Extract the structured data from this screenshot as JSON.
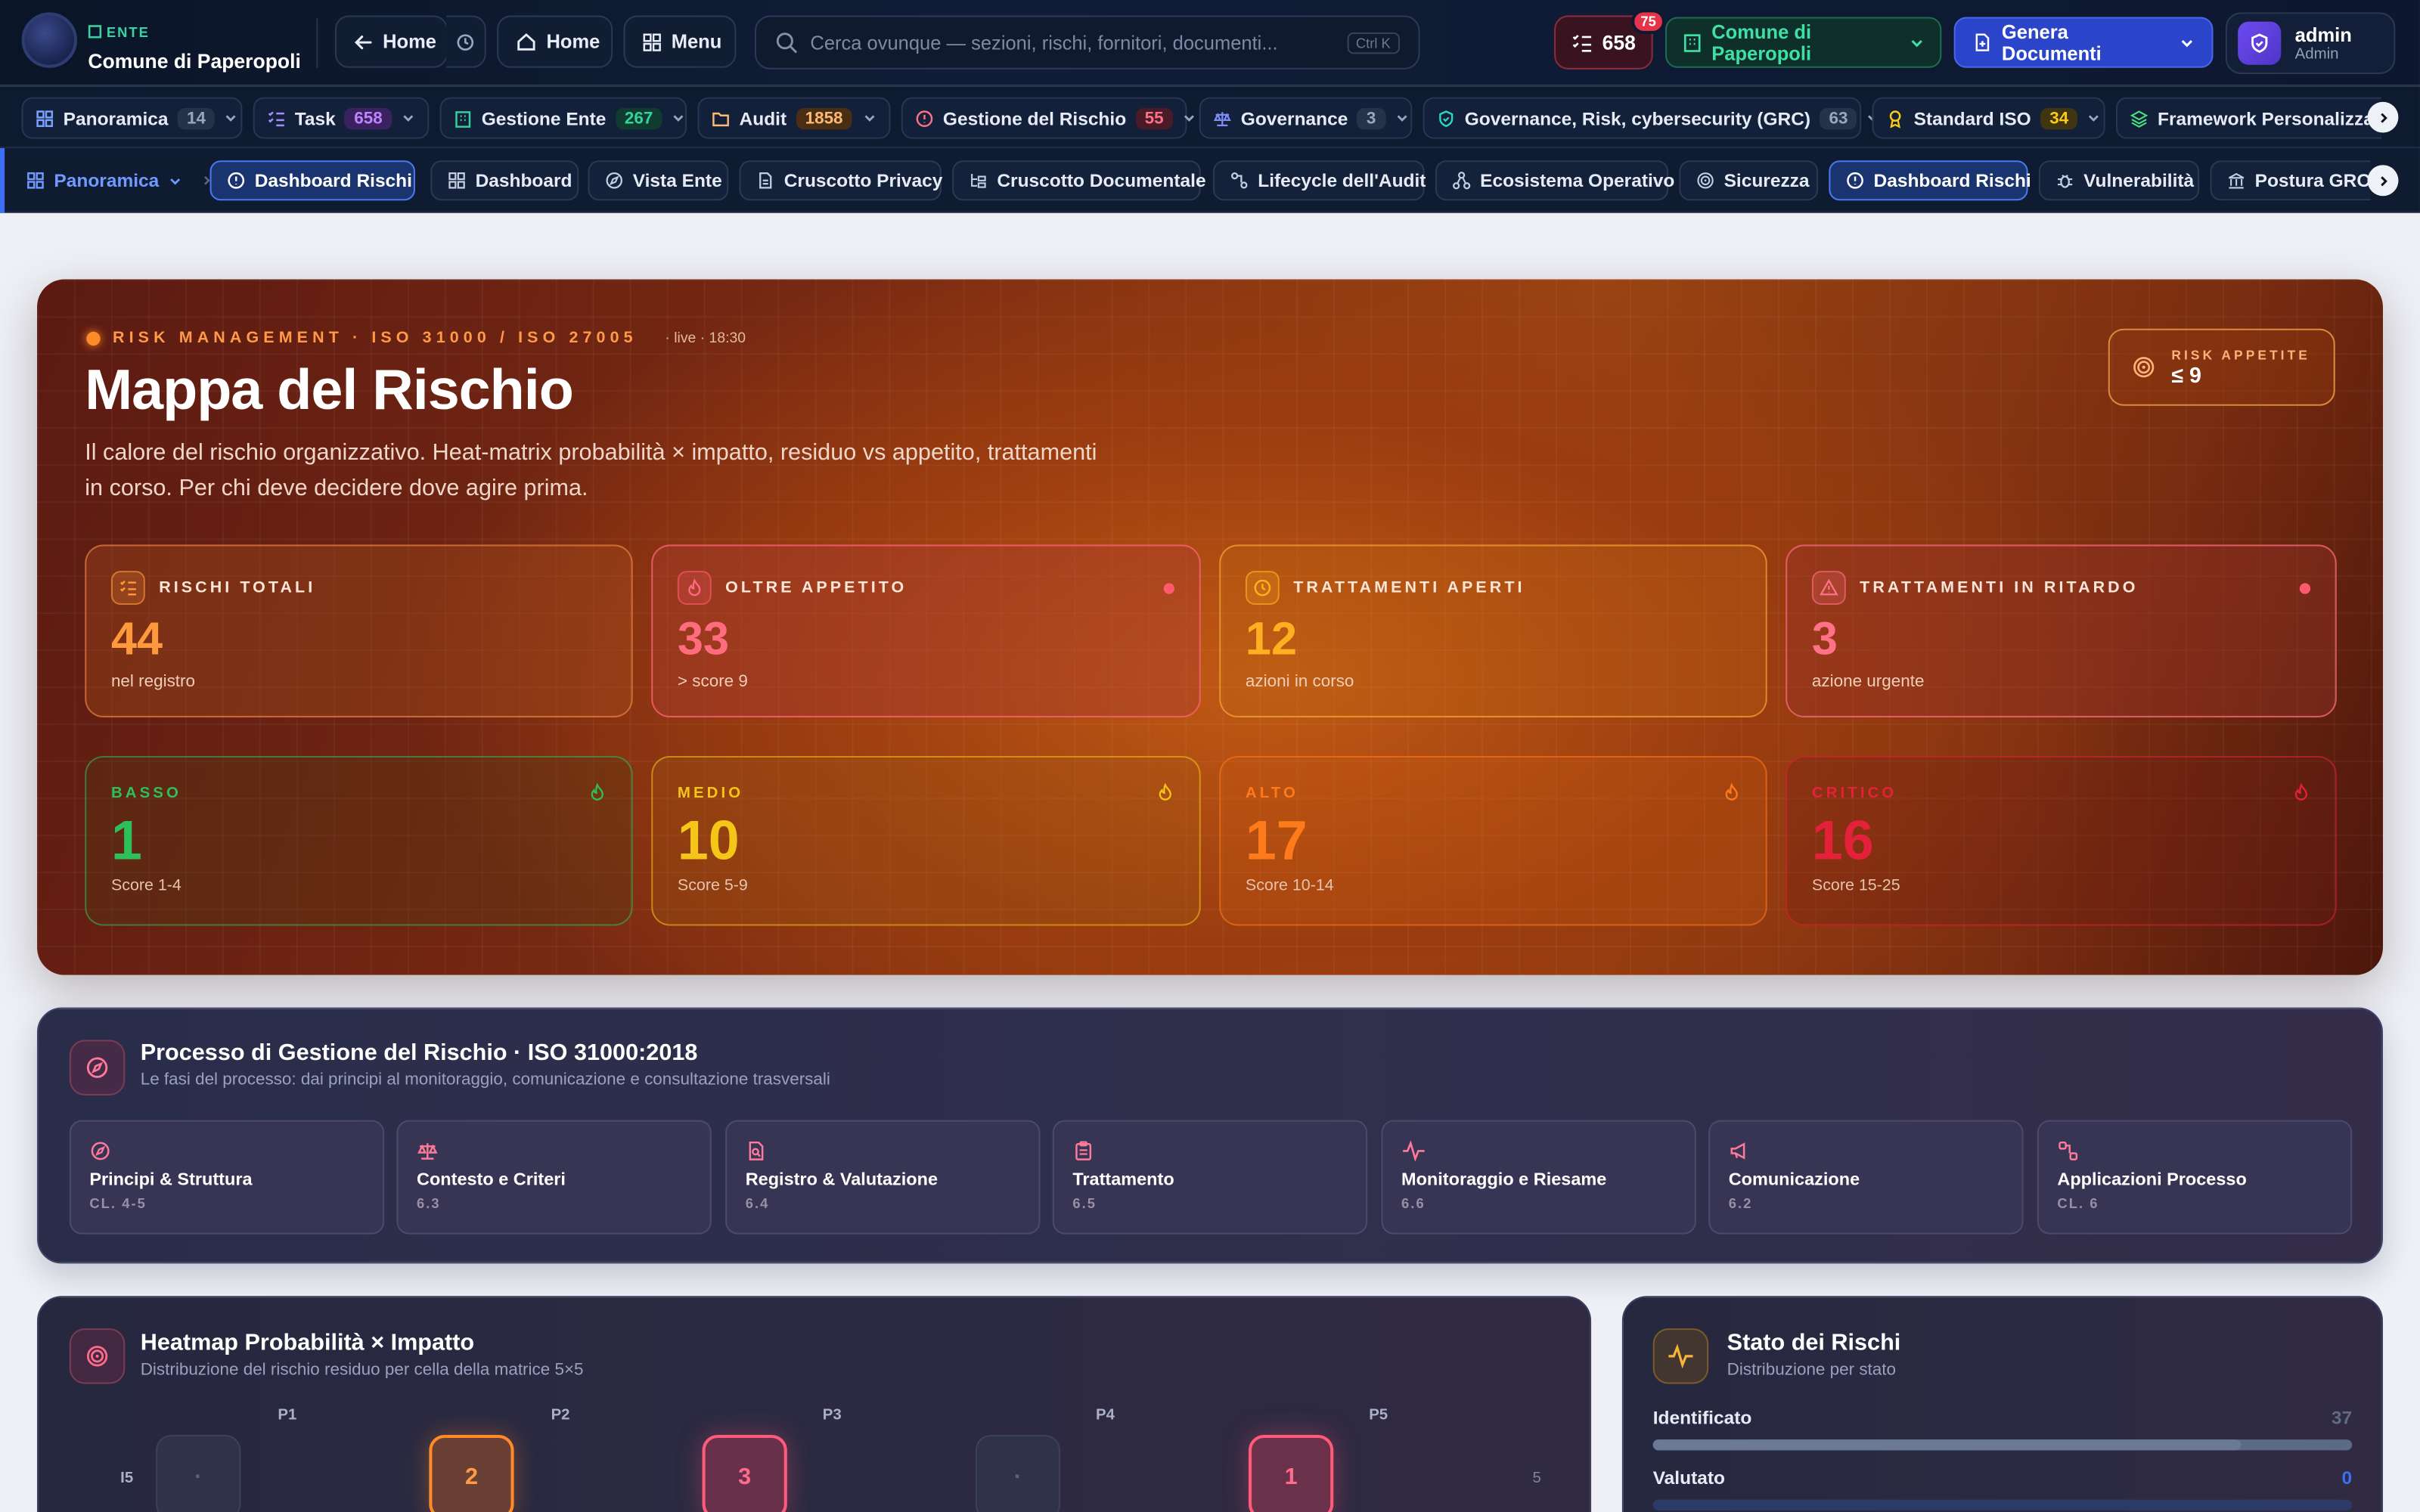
{
  "topbar": {
    "ente_tag": "ENTE",
    "ente_name": "Comune di Paperopoli",
    "back_label": "Home",
    "home_label": "Home",
    "menu_label": "Menu",
    "search_placeholder": "Cerca ovunque — sezioni, rischi, fornitori, documenti...",
    "search_shortcut": "Ctrl K",
    "tasks_count": "658",
    "notif_badge": "75",
    "ente_select": "Comune di Paperopoli",
    "generate_label": "Genera Documenti",
    "user_name": "admin",
    "user_role": "Admin"
  },
  "modules": [
    {
      "label": "Panoramica",
      "count": "14",
      "icon": "grid-icon",
      "count_color": "#9aa6bf",
      "count_bg": "#26324a"
    },
    {
      "label": "Task",
      "count": "658",
      "icon": "checklist-icon",
      "count_color": "#c084fc",
      "count_bg": "#3a2260"
    },
    {
      "label": "Gestione Ente",
      "count": "267",
      "icon": "building-icon",
      "count_color": "#34d399",
      "count_bg": "#0f3b30"
    },
    {
      "label": "Audit",
      "count": "1858",
      "icon": "folder-icon",
      "count_color": "#fdba74",
      "count_bg": "#4a2e14"
    },
    {
      "label": "Gestione del Rischio",
      "count": "55",
      "icon": "alert-circle-icon",
      "count_color": "#fb7185",
      "count_bg": "#4a1a26"
    },
    {
      "label": "Governance",
      "count": "3",
      "icon": "scale-icon",
      "count_color": "#9aa6bf",
      "count_bg": "#26324a"
    },
    {
      "label": "Governance, Risk, cybersecurity (GRC)",
      "count": "63",
      "icon": "shield-check-icon",
      "count_color": "#9aa6bf",
      "count_bg": "#26324a"
    },
    {
      "label": "Standard ISO",
      "count": "34",
      "icon": "award-icon",
      "count_color": "#facc15",
      "count_bg": "#3f3510"
    },
    {
      "label": "Framework Personalizzati",
      "count": "",
      "icon": "layers-icon",
      "count_color": "",
      "count_bg": ""
    }
  ],
  "subnav": {
    "section": "Panoramica",
    "current": "Dashboard Rischi",
    "tabs": [
      "Dashboard",
      "Vista Ente",
      "Cruscotto Privacy",
      "Cruscotto Documentale",
      "Lifecycle dell'Audit",
      "Ecosistema Operativo",
      "Sicurezza",
      "Dashboard Rischi",
      "Vulnerabilità",
      "Postura GRC"
    ]
  },
  "hero": {
    "eyebrow": "RISK MANAGEMENT · ISO 31000 / ISO 27005",
    "live": "· live · 18:30",
    "title": "Mappa del Rischio",
    "lead": "Il calore del rischio organizzativo. Heat-matrix probabilità × impatto, residuo vs appetito, trattamenti in corso. Per chi deve decidere dove agire prima.",
    "appetite_label": "RISK APPETITE",
    "appetite_value": "≤ 9"
  },
  "kpis": [
    {
      "label": "RISCHI TOTALI",
      "value": "44",
      "sub": "nel registro",
      "color": "#ff9a3c"
    },
    {
      "label": "OLTRE APPETITO",
      "value": "33",
      "sub": "> score 9",
      "color": "#ff6b7f"
    },
    {
      "label": "TRATTAMENTI APERTI",
      "value": "12",
      "sub": "azioni in corso",
      "color": "#ffb020"
    },
    {
      "label": "TRATTAMENTI IN RITARDO",
      "value": "3",
      "sub": "azione urgente",
      "color": "#ff7089"
    }
  ],
  "levels": [
    {
      "label": "BASSO",
      "value": "1",
      "range": "Score 1-4",
      "color": "#2fbf5a"
    },
    {
      "label": "MEDIO",
      "value": "10",
      "range": "Score 5-9",
      "color": "#f5c518"
    },
    {
      "label": "ALTO",
      "value": "17",
      "range": "Score 10-14",
      "color": "#ff7a1a"
    },
    {
      "label": "CRITICO",
      "value": "16",
      "range": "Score 15-25",
      "color": "#e5213a"
    }
  ],
  "process": {
    "title": "Processo di Gestione del Rischio · ISO 31000:2018",
    "subtitle": "Le fasi del processo: dai principi al monitoraggio, comunicazione e consultazione trasversali",
    "steps": [
      {
        "name": "Principi & Struttura",
        "clause": "CL. 4-5",
        "icon": "compass-icon"
      },
      {
        "name": "Contesto e Criteri",
        "clause": "6.3",
        "icon": "scale-icon"
      },
      {
        "name": "Registro & Valutazione",
        "clause": "6.4",
        "icon": "file-search-icon"
      },
      {
        "name": "Trattamento",
        "clause": "6.5",
        "icon": "clipboard-icon"
      },
      {
        "name": "Monitoraggio e Riesame",
        "clause": "6.6",
        "icon": "activity-icon"
      },
      {
        "name": "Comunicazione",
        "clause": "6.2",
        "icon": "megaphone-icon"
      },
      {
        "name": "Applicazioni Processo",
        "clause": "CL. 6",
        "icon": "workflow-icon"
      }
    ]
  },
  "heatmap": {
    "title": "Heatmap Probabilità × Impatto",
    "subtitle": "Distribuzione del rischio residuo per cella della matrice 5×5",
    "col_labels": [
      "P1",
      "P2",
      "P3",
      "P4",
      "P5"
    ],
    "row_label": "I5",
    "row_total": "5",
    "cells": [
      {
        "value": "·",
        "level": "empty"
      },
      {
        "value": "2",
        "level": "alto"
      },
      {
        "value": "3",
        "level": "critico"
      },
      {
        "value": "·",
        "level": "empty"
      },
      {
        "value": "1",
        "level": "critico"
      }
    ]
  },
  "states": {
    "title": "Stato dei Rischi",
    "subtitle": "Distribuzione per stato",
    "items": [
      {
        "label": "Identificato",
        "value": "37",
        "share": 0.84
      },
      {
        "label": "Valutato",
        "value": "0",
        "share": 0
      }
    ]
  }
}
